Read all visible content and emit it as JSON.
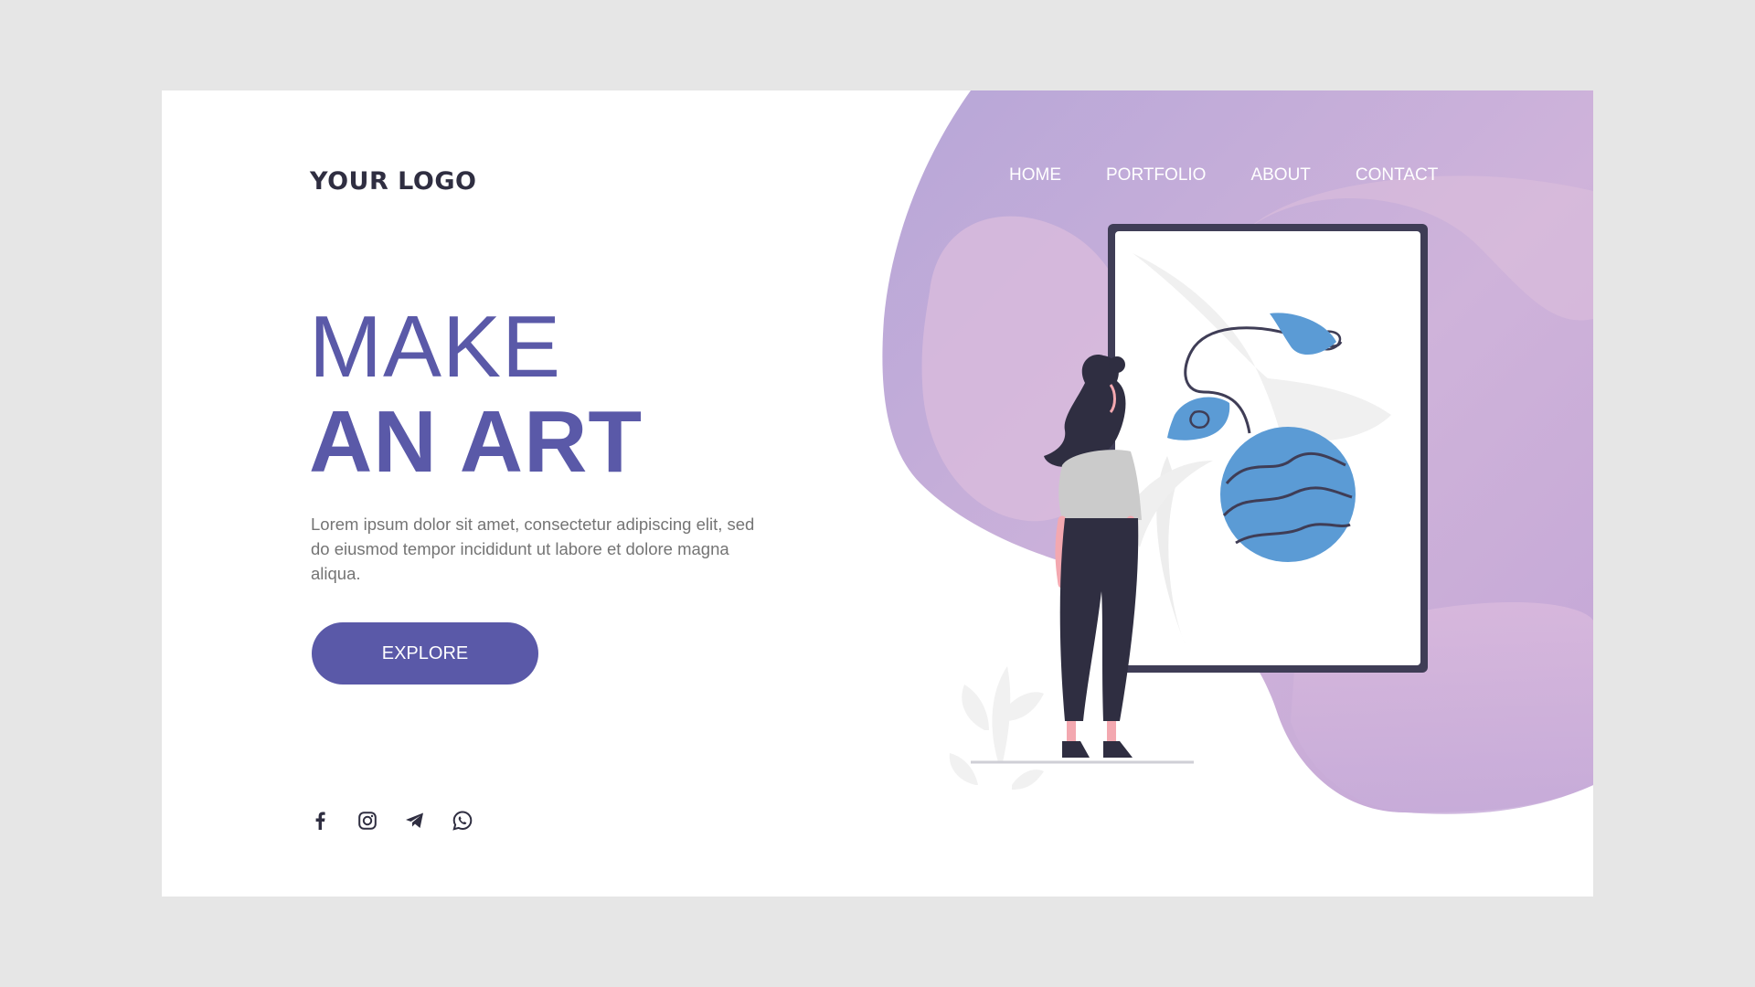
{
  "brand": {
    "logo_text": "YOUR LOGO"
  },
  "nav": {
    "items": [
      {
        "label": "HOME"
      },
      {
        "label": "PORTFOLIO"
      },
      {
        "label": "ABOUT"
      },
      {
        "label": "CONTACT"
      }
    ]
  },
  "hero": {
    "title_line1": "MAKE",
    "title_line2": "AN ART",
    "description": "Lorem ipsum dolor sit amet, consectetur adipiscing elit, sed do eiusmod tempor incididunt ut labore et dolore magna aliqua.",
    "cta_label": "EXPLORE"
  },
  "social": {
    "icons": [
      "facebook-icon",
      "instagram-icon",
      "telegram-icon",
      "whatsapp-icon"
    ]
  },
  "colors": {
    "page_background": "#e6e6e6",
    "card_background": "#ffffff",
    "accent": "#5a59a8",
    "blob_gradient_start": "#b9a7d8",
    "blob_gradient_end": "#dcb9d8",
    "dark": "#2f2e41",
    "art_blue": "#5b9bd5"
  }
}
